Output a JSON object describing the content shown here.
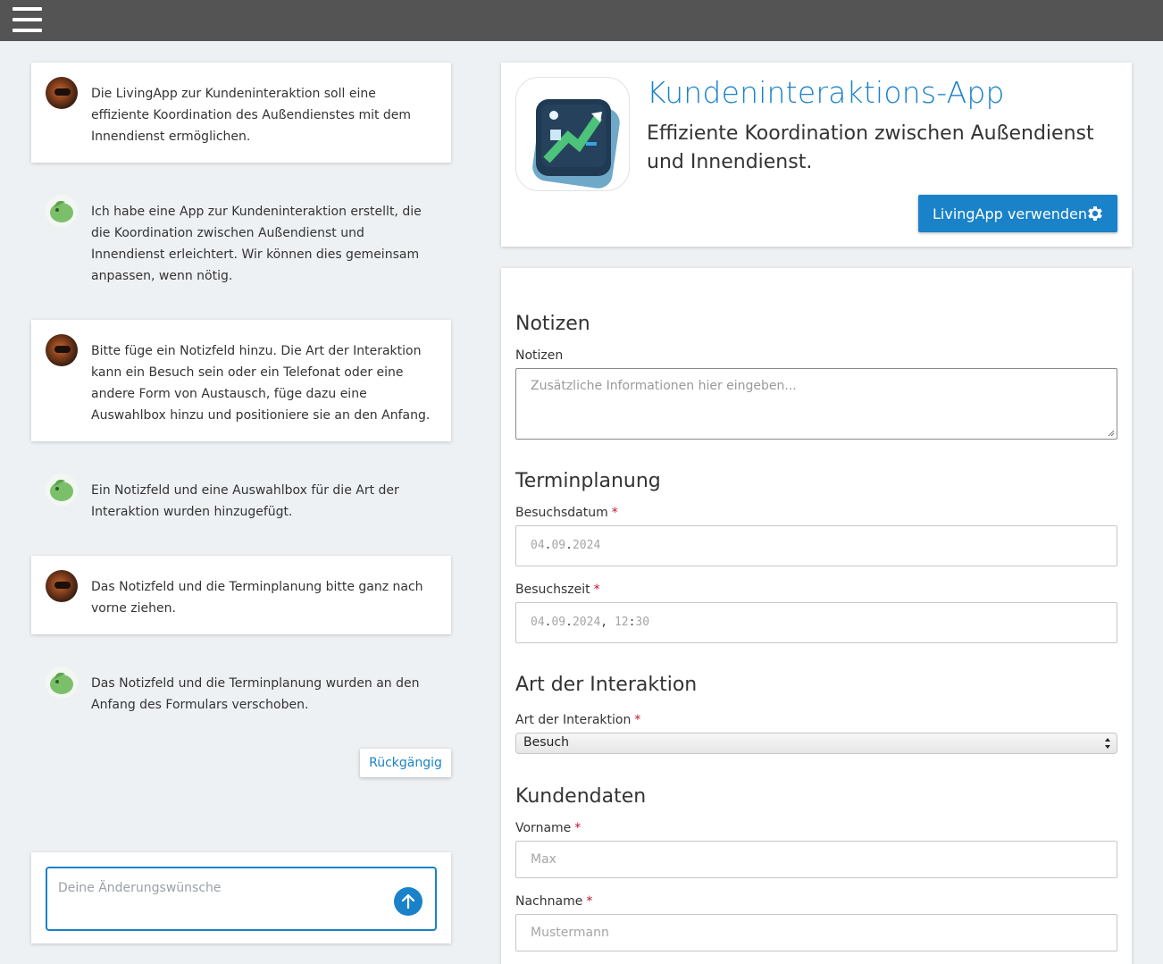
{
  "chat": {
    "messages": [
      {
        "role": "user",
        "text": "Die LivingApp zur Kundeninteraktion soll eine effiziente Koordination des Außendienstes mit dem Innendienst ermöglichen."
      },
      {
        "role": "assistant",
        "text": "Ich habe eine App zur Kundeninteraktion erstellt, die die Koordination zwischen Außendienst und Innendienst erleichtert. Wir können dies gemeinsam anpassen, wenn nötig."
      },
      {
        "role": "user",
        "text": "Bitte füge ein Notizfeld hinzu. Die Art der Interaktion kann ein Besuch sein oder ein Telefonat oder eine andere Form von Austausch, füge dazu eine Auswahlbox hinzu und positioniere sie an den Anfang."
      },
      {
        "role": "assistant",
        "text": "Ein Notizfeld und eine Auswahlbox für die Art der Interaktion wurden hinzugefügt."
      },
      {
        "role": "user",
        "text": "Das Notizfeld und die Terminplanung bitte ganz nach vorne ziehen."
      },
      {
        "role": "assistant",
        "text": "Das Notizfeld und die Terminplanung wurden an den Anfang des Formulars verschoben."
      }
    ],
    "undo_label": "Rückgängig",
    "input_placeholder": "Deine Änderungswünsche"
  },
  "app": {
    "title": "Kundeninteraktions-App",
    "subtitle": "Effiziente Koordination zwischen Außendienst und Innendienst.",
    "use_button_label": "LivingApp verwenden"
  },
  "form": {
    "notes_section": "Notizen",
    "notes_label": "Notizen",
    "notes_placeholder": "Zusätzliche Informationen hier eingeben...",
    "schedule_section": "Terminplanung",
    "visit_date_label": "Besuchsdatum",
    "visit_date": {
      "dd": "04",
      "mm": "09",
      "yyyy": "2024"
    },
    "visit_time_label": "Besuchszeit",
    "visit_time": {
      "dd": "04",
      "mm": "09",
      "yyyy": "2024",
      "hh": "12",
      "min": "30"
    },
    "interaction_section": "Art der Interaktion",
    "interaction_label": "Art der Interaktion",
    "interaction_value": "Besuch",
    "customer_section": "Kundendaten",
    "firstname_label": "Vorname",
    "firstname_placeholder": "Max",
    "lastname_label": "Nachname",
    "lastname_placeholder": "Mustermann",
    "required_mark": "*"
  },
  "colors": {
    "accent": "#1a82c8",
    "topbar": "#545454",
    "background": "#eef1f4",
    "required": "#c8102e"
  },
  "icons": {
    "menu": "hamburger-icon",
    "send": "arrow-up-icon",
    "settings": "gear-icon"
  }
}
